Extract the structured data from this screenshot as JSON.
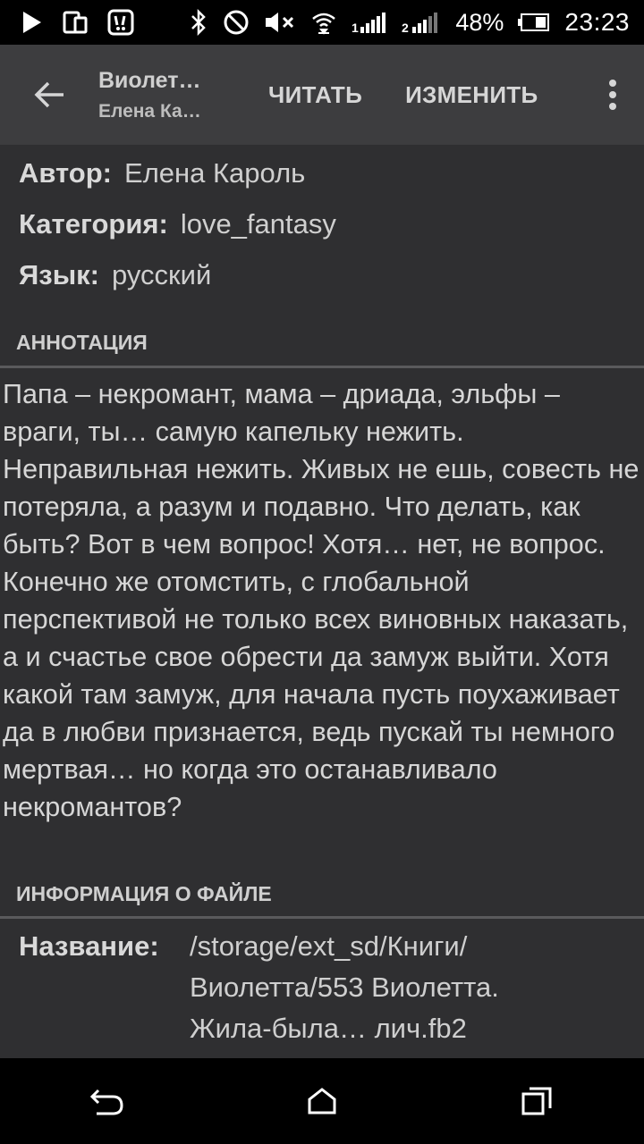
{
  "status_bar": {
    "battery": "48%",
    "time": "23:23",
    "icons": [
      "play-icon",
      "device-icon",
      "notification-icon",
      "bluetooth-icon",
      "do-not-disturb-icon",
      "mute-icon",
      "wifi-icon",
      "signal-1-icon",
      "signal-2-icon",
      "battery-icon"
    ]
  },
  "toolbar": {
    "title": "Виолет…",
    "subtitle": "Елена Ка…",
    "read_label": "ЧИТАТЬ",
    "edit_label": "ИЗМЕНИТЬ"
  },
  "meta": {
    "author_label": "Автор:",
    "author_value": "Елена Кароль",
    "category_label": "Категория:",
    "category_value": "love_fantasy",
    "language_label": "Язык:",
    "language_value": "русский"
  },
  "annotation": {
    "header": "АННОТАЦИЯ",
    "text": "Папа – некромант, мама – дриада, эльфы – враги, ты… самую капельку нежить. Неправильная нежить. Живых не ешь, совесть не потеряла, а разум и подавно. Что делать, как быть? Вот в чем вопрос! Хотя… нет, не вопрос. Конечно же отомстить, с глобальной перспективой не только всех виновных наказать, а и счастье свое обрести да замуж выйти. Хотя какой там замуж, для начала пусть поухаживает да в любви признается, ведь пускай ты немного мертвая… но когда это останавливало некромантов?"
  },
  "file_info": {
    "header": "ИНФОРМАЦИЯ О ФАЙЛЕ",
    "name_label": "Название:",
    "name_value": "/storage/ext_sd/Книги/Виолетта/553 Виолетта. Жила-была… лич.fb2"
  }
}
